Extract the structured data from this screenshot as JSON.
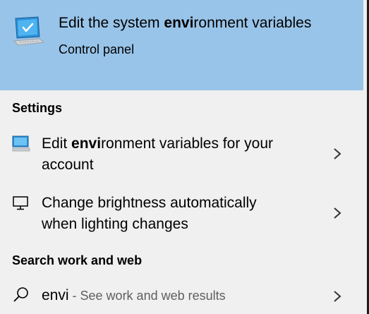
{
  "best_match": {
    "title_pre": "Edit the system ",
    "title_bold": "envi",
    "title_post": "ronment variables",
    "subtitle": "Control panel",
    "icon": "monitor-check-icon"
  },
  "sections": {
    "settings_header": "Settings",
    "web_header": "Search work and web"
  },
  "settings_items": [
    {
      "pre": "Edit ",
      "bold": "envi",
      "post": "ronment variables for your account",
      "icon": "monitor-settings-icon"
    },
    {
      "text": "Change brightness automatically when lighting changes",
      "icon": "display-icon"
    }
  ],
  "web_item": {
    "query": "envi",
    "suffix": " - See work and web results",
    "icon": "search-icon"
  },
  "colors": {
    "highlight": "#99c4e9",
    "background": "#f0f0f0",
    "muted_text": "#5f5f5f"
  }
}
